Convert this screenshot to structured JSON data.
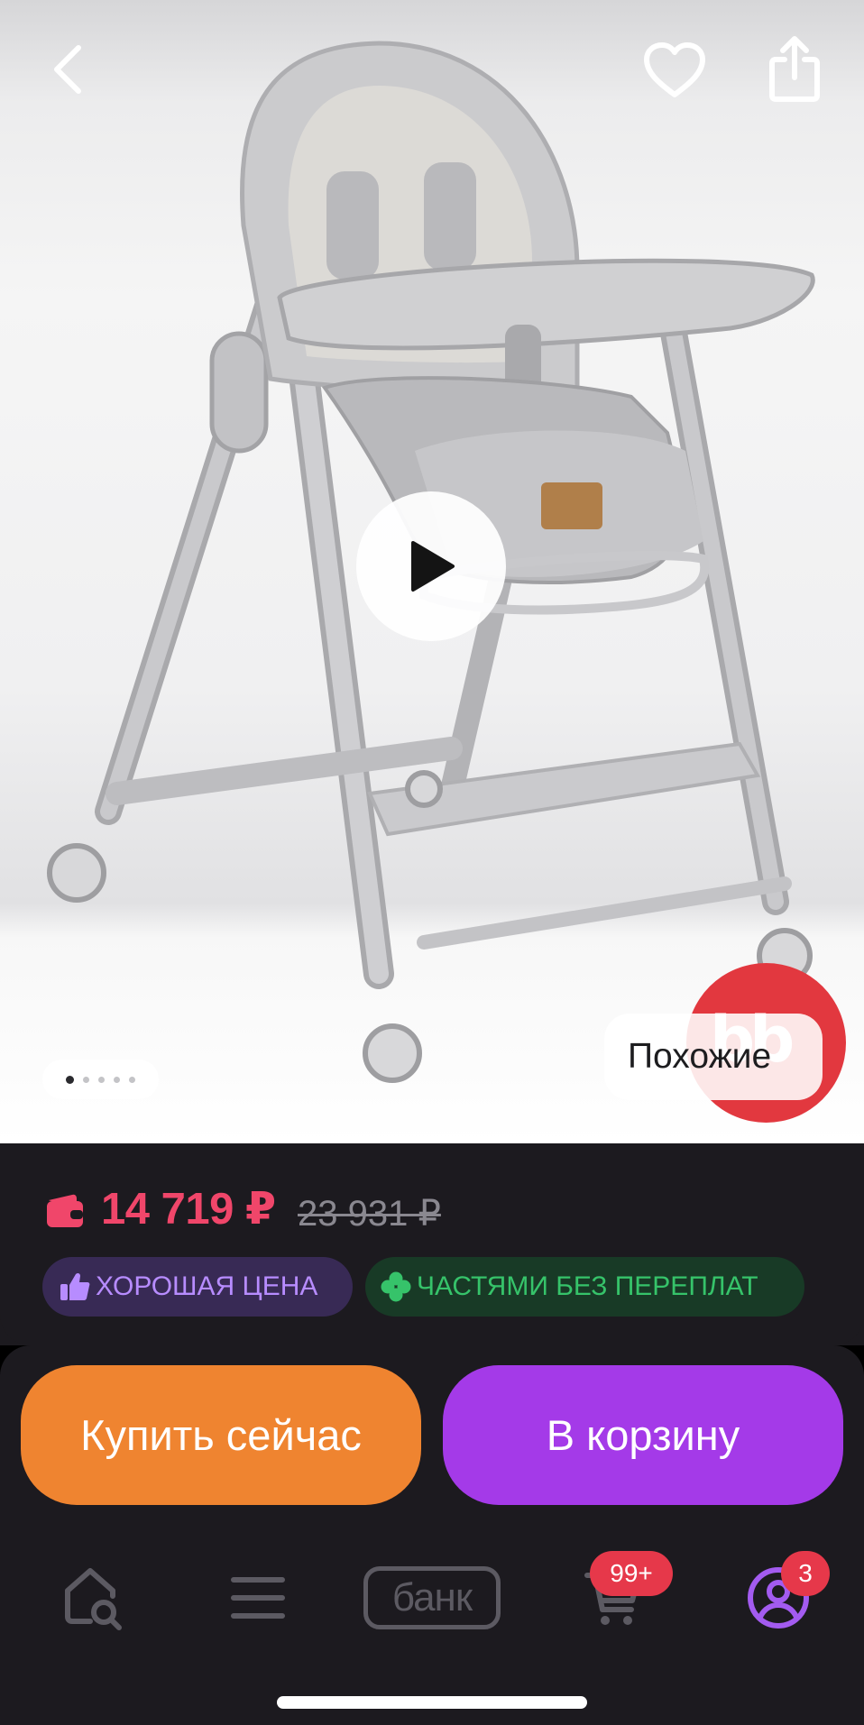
{
  "gallery": {
    "similar_label": "Похожие",
    "brand_badge_text": "bb",
    "image_count": 5,
    "active_image": 1
  },
  "product": {
    "price": "14 719 ₽",
    "old_price": "23 931 ₽",
    "price_color": "#f0466a"
  },
  "chips": {
    "good_price": "ХОРОШАЯ ЦЕНА",
    "installments": "ЧАСТЯМИ БЕЗ ПЕРЕПЛАТ"
  },
  "actions": {
    "buy_now": "Купить сейчас",
    "add_to_cart": "В корзину",
    "buy_now_color": "#ef8430",
    "cart_color": "#a43ae8"
  },
  "nav": {
    "bank_label": "банк",
    "cart_badge": "99+",
    "profile_badge": "3"
  }
}
